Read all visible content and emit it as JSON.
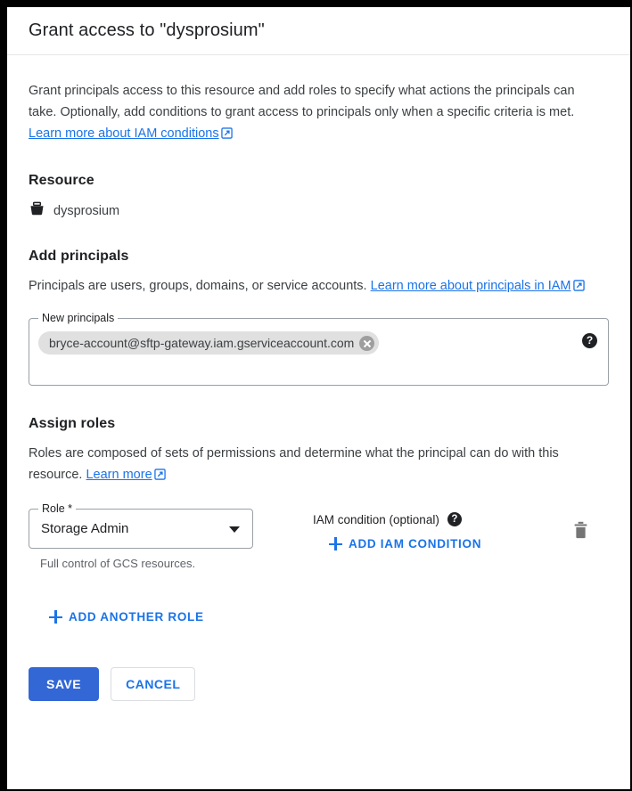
{
  "dialog": {
    "title": "Grant access to \"dysprosium\"",
    "description_part1": "Grant principals access to this resource and add roles to specify what actions the principals can take. Optionally, add conditions to grant access to principals only when a specific criteria is met. ",
    "description_link": "Learn more about IAM conditions"
  },
  "resource": {
    "heading": "Resource",
    "icon": "bucket-icon",
    "name": "dysprosium"
  },
  "add_principals": {
    "heading": "Add principals",
    "description_part1": "Principals are users, groups, domains, or service accounts. ",
    "description_link": "Learn more about principals in IAM",
    "field_label": "New principals",
    "field_placeholder": "",
    "chips": [
      {
        "text": "bryce-account@sftp-gateway.iam.gserviceaccount.com",
        "remove_icon": "close-circle-icon"
      }
    ],
    "help_icon": "help-icon",
    "help_icon_glyph": "?"
  },
  "assign_roles": {
    "heading": "Assign roles",
    "description_part1": "Roles are composed of sets of permissions and determine what the principal can do with this resource. ",
    "description_link": "Learn more",
    "role_field_label": "Role *",
    "role_selected": "Storage Admin",
    "role_options": [
      "Storage Admin"
    ],
    "role_helper_text": "Full control of GCS resources.",
    "condition_label": "IAM condition (optional)",
    "condition_help_glyph": "?",
    "add_condition_label": "ADD IAM CONDITION",
    "delete_icon": "trash-icon",
    "add_another_role_label": "ADD ANOTHER ROLE"
  },
  "footer": {
    "save_label": "SAVE",
    "cancel_label": "CANCEL"
  },
  "colors": {
    "accent_link": "#1a73e8",
    "primary_button": "#3367d6",
    "chip_background": "#e0e0e0",
    "text_primary": "#202124",
    "text_secondary": "#5f6368"
  }
}
